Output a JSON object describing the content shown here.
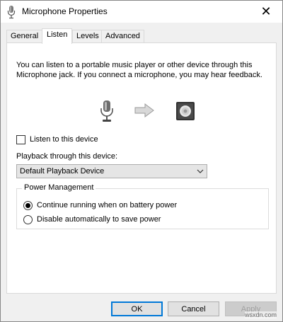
{
  "window": {
    "title": "Microphone Properties",
    "close_glyph": "✕"
  },
  "tabs": [
    {
      "label": "General",
      "active": false
    },
    {
      "label": "Listen",
      "active": true
    },
    {
      "label": "Levels",
      "active": false
    },
    {
      "label": "Advanced",
      "active": false
    }
  ],
  "listen": {
    "description": "You can listen to a portable music player or other device through this Microphone jack.  If you connect a microphone, you may hear feedback.",
    "listen_checkbox_label": "Listen to this device",
    "listen_checked": false,
    "playback_label": "Playback through this device:",
    "playback_selected": "Default Playback Device",
    "power_group_title": "Power Management",
    "power_options": [
      {
        "label": "Continue running when on battery power",
        "selected": true
      },
      {
        "label": "Disable automatically to save power",
        "selected": false
      }
    ]
  },
  "buttons": {
    "ok": "OK",
    "cancel": "Cancel",
    "apply": "Apply"
  },
  "watermark": "wsxdn.com",
  "icons": {
    "title": "microphone-icon",
    "source": "microphone-device-icon",
    "flow": "right-arrow-icon",
    "target": "speaker-icon",
    "dropdown": "chevron-down-icon"
  },
  "colors": {
    "accent": "#0078d7",
    "window_bg": "#f0f0f0",
    "panel_bg": "#ffffff"
  }
}
